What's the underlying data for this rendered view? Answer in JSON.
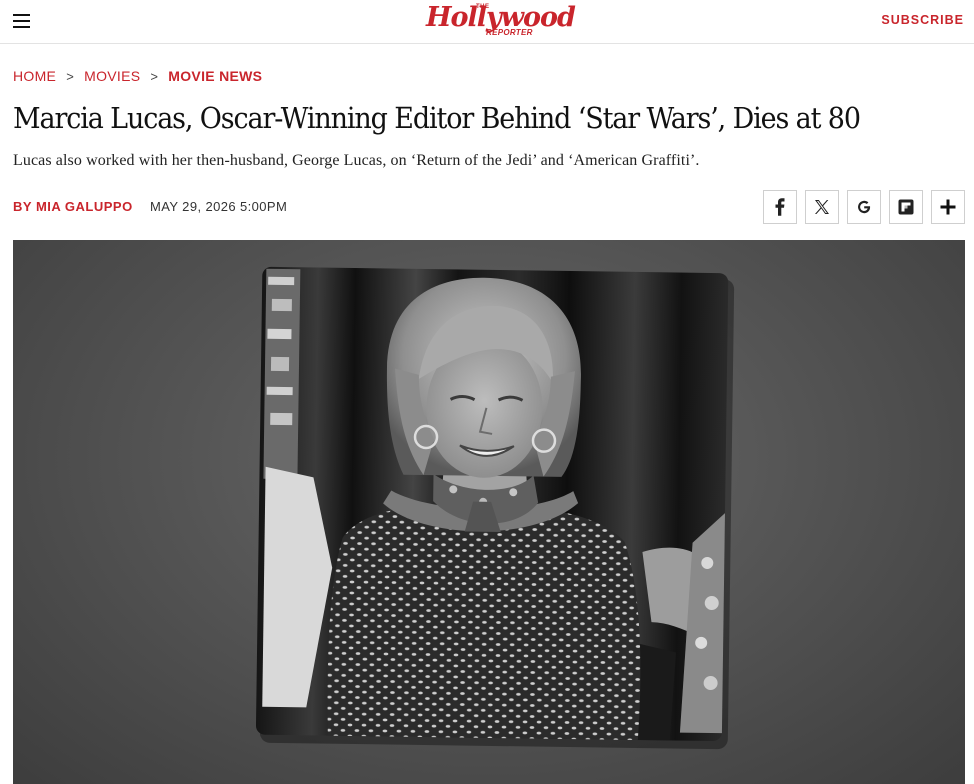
{
  "header": {
    "logo_the": "THE",
    "logo_main": "Hollywood",
    "logo_reporter": "REPORTER",
    "subscribe_label": "SUBSCRIBE"
  },
  "breadcrumb": {
    "items": [
      "HOME",
      "MOVIES",
      "MOVIE NEWS"
    ],
    "separator": ">"
  },
  "article": {
    "title": "Marcia Lucas, Oscar-Winning Editor Behind ‘Star Wars’, Dies at 80",
    "dek": "Lucas also worked with her then-husband, George Lucas, on ‘Return of the Jedi’ and ‘American Graffiti’.",
    "byline_prefix": "BY",
    "author": "MIA GALUPPO",
    "date": "MAY 29, 2026 5:00PM"
  },
  "share_icons": [
    "facebook-icon",
    "x-icon",
    "google-icon",
    "flipboard-icon",
    "plus-icon"
  ],
  "colors": {
    "brand_red": "#c9252c",
    "text": "#111111"
  }
}
